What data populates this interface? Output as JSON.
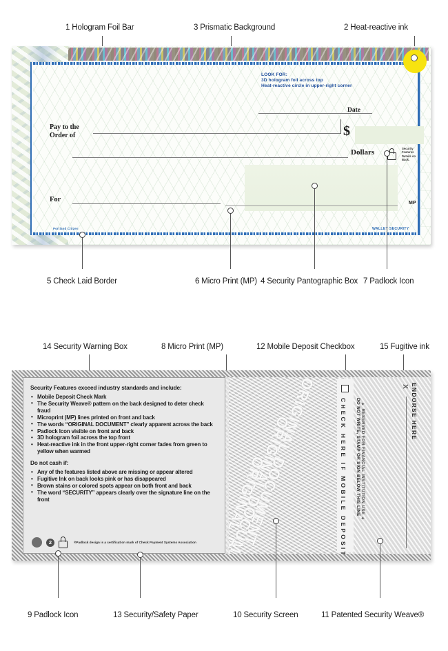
{
  "top_callouts": [
    {
      "id": "1",
      "label": "1 Hologram Foil Bar"
    },
    {
      "id": "3",
      "label": "3 Prismatic Background"
    },
    {
      "id": "2",
      "label": "2 Heat-reactive ink"
    }
  ],
  "front_bottom_callouts": [
    {
      "id": "5",
      "label": "5 Check Laid Border"
    },
    {
      "id": "6",
      "label": "6 Micro Print (MP)"
    },
    {
      "id": "4",
      "label": "4 Security Pantographic Box"
    },
    {
      "id": "7",
      "label": "7 Padlock Icon"
    }
  ],
  "back_top_callouts": [
    {
      "id": "14",
      "label": "14 Security Warning Box"
    },
    {
      "id": "8",
      "label": "8 Micro Print (MP)"
    },
    {
      "id": "12",
      "label": "12 Mobile Deposit Checkbox"
    },
    {
      "id": "15",
      "label": "15 Fugitive ink"
    }
  ],
  "back_bottom_callouts": [
    {
      "id": "9",
      "label": "9 Padlock Icon"
    },
    {
      "id": "13",
      "label": "13 Security/Safety Paper"
    },
    {
      "id": "10",
      "label": "10 Security Screen"
    },
    {
      "id": "11",
      "label": "11 Patented Security Weave®"
    }
  ],
  "front_check": {
    "look_for_title": "LOOK FOR:",
    "look_for_line1": "3D hologram foil across top",
    "look_for_line2": "Heat-reactive circle in upper-right corner",
    "pay_to_line1": "Pay to the",
    "pay_to_line2": "Order of",
    "date_label": "Date",
    "dollars_label": "Dollars",
    "for_label": "For",
    "dollar_sign": "$",
    "mp_mark": "MP",
    "security_note": "Security\nFeatures\nDetails on\nBack.",
    "microprint_bottom_left": "Portland Citizen",
    "microprint_bottom_right": "WALLET SECURITY"
  },
  "back_check": {
    "warning_heading": "Security Features exceed industry standards and include:",
    "features": [
      "Mobile Deposit Check Mark",
      "The Security Weave® pattern on the back designed to deter check fraud",
      "Microprint (MP) lines printed on front and back",
      "The words “ORIGINAL DOCUMENT” clearly apparent across the back",
      "Padlock Icon visible on front and back",
      "3D hologram foil across the top front",
      "Heat-reactive ink in the front upper-right corner fades from green to yellow when warmed"
    ],
    "donotcash_heading": "Do not cash if:",
    "donotcash": [
      "Any of the features listed above are missing or appear altered",
      "Fugitive Ink on back looks pink or has disappeared",
      "Brown stains or colored spots appear on both front and back",
      "The word “SECURITY” appears clearly over the signature line on the front"
    ],
    "footer_badge_number": "2",
    "footer_note": "®Padlock design is a certification mark of Check Payment Systems Association",
    "watermark": "ORIGINAL DOCUMENT",
    "mobile_deposit_label": "CHECK HERE IF MOBILE DEPOSIT",
    "no_write_line1": "DO NOT WRITE, STAMP OR SIGN BELOW THIS LINE",
    "no_write_line2": "✦ RESERVED FOR FINANCIAL INSTITUTION USE ✦",
    "endorse_here": "ENDORSE HERE",
    "endorse_x": "X"
  },
  "colors": {
    "heat_ink": "#f7e310",
    "border_blue": "#2f6db5",
    "pantograph_green": "#e9f1e0",
    "paper_gray": "#e3e3e3"
  }
}
